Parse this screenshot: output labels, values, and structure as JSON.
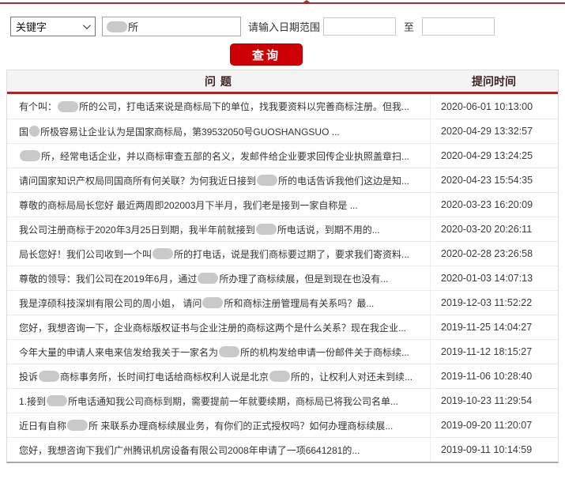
{
  "colors": {
    "accent_red": "#cc0005",
    "top_line_red": "#9c3138",
    "header_underline_red": "#a2272e",
    "header_text": "#3b2326",
    "row_text": "#333333",
    "redaction_gray": "#c9c9c9"
  },
  "search": {
    "keyword_option": "关键字",
    "keyword_value": "██所",
    "date_range_label": "请输入日期范围",
    "date_from_value": "",
    "date_to_value": "",
    "to_label": "至",
    "query_button": "查询"
  },
  "table": {
    "headers": [
      "问 题",
      "提问时间"
    ],
    "rows": [
      {
        "q": "有个叫：██所的公司，打电话来说是商标局下的单位，找我要资料以完善商标注册。但我...",
        "time": "2020-06-01 10:13:00"
      },
      {
        "q": "国█所极容易让企业认为是国家商标局，第39532050号GUOSHANGSUO ...",
        "time": "2020-04-29 13:32:57"
      },
      {
        "q": "██所，经常电话企业，并以商标审查五部的名义，发邮件给企业要求回传企业执照盖章扫...",
        "time": "2020-04-29 13:24:25"
      },
      {
        "q": "请问国家知识产权局同国商所有何关联？为何我近日接到██所的电话告诉我他们这边是知...",
        "time": "2020-04-23 15:54:35"
      },
      {
        "q": "尊敬的商标局局长您好 最近两周即202003月下半月，我们老是接到一家自称是 ...",
        "time": "2020-03-23 16:20:09"
      },
      {
        "q": "我公司注册商标于2020年3月25日到期，我半年前就接到██所电话说，到期不用的...",
        "time": "2020-03-20 20:26:11"
      },
      {
        "q": "局长您好！我们公司收到一个叫██所的打电话，说是我们商标要过期了，要求我们寄资料...",
        "time": "2020-02-28 23:26:58"
      },
      {
        "q": "尊敬的领导：我们公司在2019年6月，通过██所办理了商标续展，但是到现在也没有...",
        "time": "2020-01-03 14:07:13"
      },
      {
        "q": "我是淳硕科技深圳有限公司的周小姐， 请问██所和商标注册管理局有关系吗？最...",
        "time": "2019-12-03 11:52:22"
      },
      {
        "q": "您好，我想咨询一下，企业商标版权证书与企业注册的商标这两个是什么关系？现在我企业...",
        "time": "2019-11-25 14:04:27"
      },
      {
        "q": "今年大量的申请人来电来信发给我关于一家名为██所的机构发给申请一份邮件关于商标续...",
        "time": "2019-11-12 18:15:27"
      },
      {
        "q": "投诉██商标事务所，长时间打电话给商标权利人说是北京██所的，让权利人对还未到续...",
        "time": "2019-11-06 10:28:40"
      },
      {
        "q": "1.接到██所电话通知我公司商标到期，需要提前一年就要续期，商标局已将我公司名单...",
        "time": "2019-10-23 11:29:54"
      },
      {
        "q": "近日有自称 ██所 来联系办理商标续展业务，有你们的正式授权吗？如何办理商标续展...",
        "time": "2019-09-20 11:20:07"
      },
      {
        "q": "您好，我想咨询下我们广州腾讯机房设备有限公司2008年申请了一项6641281的...",
        "time": "2019-09-11 10:14:59"
      }
    ]
  }
}
